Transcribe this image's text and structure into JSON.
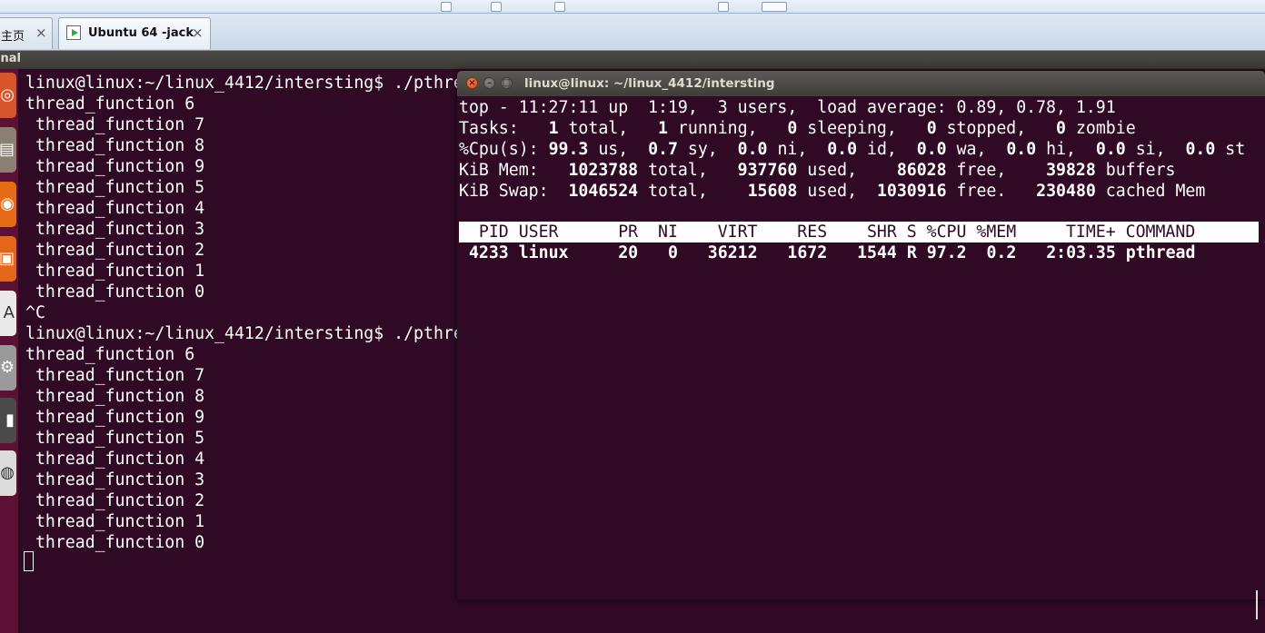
{
  "host": {
    "tabs": [
      {
        "label": "主页",
        "close": "×"
      },
      {
        "label": "Ubuntu 64 -jack",
        "close": "×"
      }
    ]
  },
  "ubuntu": {
    "app_title": "inal"
  },
  "launcher": {
    "icons": [
      {
        "name": "dash-icon",
        "color": "#d8542a"
      },
      {
        "name": "files-icon",
        "color": "#8a7f70"
      },
      {
        "name": "firefox-icon",
        "color": "#e56b15"
      },
      {
        "name": "software-center-icon",
        "color": "#e3661b"
      },
      {
        "name": "libreoffice-icon",
        "color": "#e9e9e9"
      },
      {
        "name": "settings-icon",
        "color": "#9a9a9a"
      },
      {
        "name": "terminal-icon",
        "color": "#4a4a4a"
      },
      {
        "name": "dvd-icon",
        "color": "#dcdcdc"
      }
    ]
  },
  "bg_terminal": {
    "lines": [
      "linux@linux:~/linux_4412/intersting$ ./pthre",
      "thread_function 6",
      " thread_function 7",
      " thread_function 8",
      " thread_function 9",
      " thread_function 5",
      " thread_function 4",
      " thread_function 3",
      " thread_function 2",
      " thread_function 1",
      " thread_function 0",
      "^C",
      "linux@linux:~/linux_4412/intersting$ ./pthre",
      "thread_function 6",
      " thread_function 7",
      " thread_function 8",
      " thread_function 9",
      " thread_function 5",
      " thread_function 4",
      " thread_function 3",
      " thread_function 2",
      " thread_function 1",
      " thread_function 0"
    ]
  },
  "top_window": {
    "title": "linux@linux: ~/linux_4412/intersting",
    "buttons": {
      "close": "×",
      "minimize": "–",
      "maximize": "□"
    },
    "summary": {
      "line1": "top - 11:27:11 up  1:19,  3 users,  load average: 0.89, 0.78, 1.91",
      "tasks": {
        "label": "Tasks:",
        "total": "1",
        "running": "1",
        "sleeping": "0",
        "stopped": "0",
        "zombie": "0"
      },
      "cpu": {
        "label": "%Cpu(s):",
        "us": "99.3",
        "sy": "0.7",
        "ni": "0.0",
        "id": "0.0",
        "wa": "0.0",
        "hi": "0.0",
        "si": "0.0",
        "st": "0.0"
      },
      "mem": {
        "label": "KiB Mem:",
        "total": "1023788",
        "used": "937760",
        "free": "86028",
        "buffers": "39828"
      },
      "swap": {
        "label": "KiB Swap:",
        "total": "1046524",
        "used": "15608",
        "free": "1030916",
        "cached": "230480"
      }
    },
    "process_header": "  PID USER      PR  NI    VIRT    RES    SHR S %CPU %MEM     TIME+ COMMAND",
    "process_row": {
      "pid": "4233",
      "user": "linux",
      "pr": "20",
      "ni": "0",
      "virt": "36212",
      "res": "1672",
      "shr": "1544",
      "s": "R",
      "cpu": "97.2",
      "mem": "0.2",
      "time": "2:03.35",
      "command": "pthread"
    }
  }
}
